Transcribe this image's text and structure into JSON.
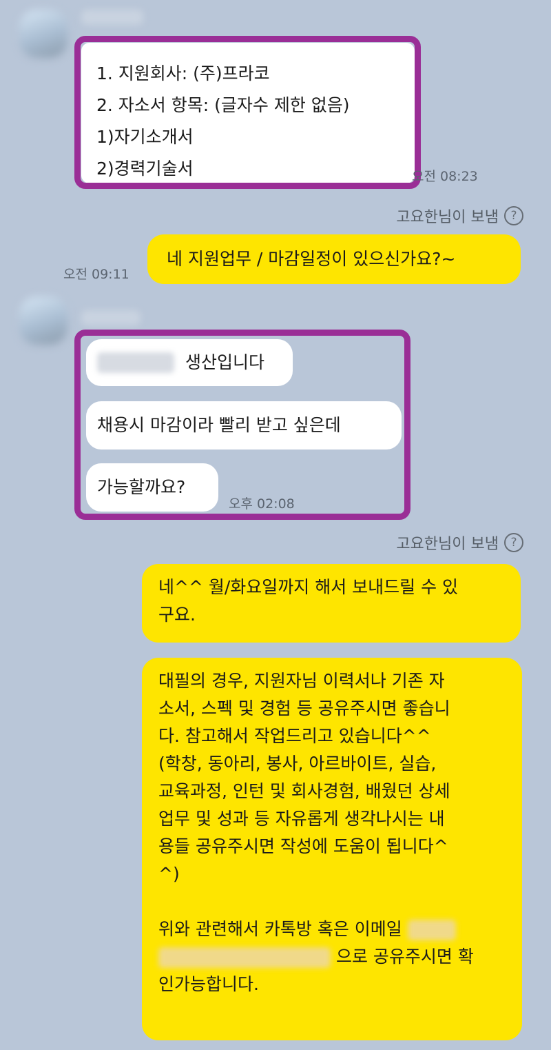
{
  "messages": {
    "first_received": {
      "lines": [
        "1. 지원회사: (주)프라코",
        "2. 자소서 항목: (글자수 제한 없음)",
        "1)자기소개서",
        "2)경력기술서"
      ],
      "time": "오전 08:23"
    },
    "sent_notice_1": "고요한님이 보냄",
    "question": {
      "text": "네 지원업무 / 마감일정이 있으신가요?~",
      "time": "오전 09:11"
    },
    "second_received": {
      "bubble1": "생산입니다",
      "bubble2": "채용시 마감이라 빨리 받고 싶은데",
      "bubble3": "가능할까요?",
      "time": "오후 02:08"
    },
    "sent_notice_2": "고요한님이 보냄",
    "reply1": {
      "lines": [
        "네^^ 월/화요일까지 해서 보내드릴 수 있",
        "구요."
      ]
    },
    "reply2": {
      "lines": [
        "대필의 경우, 지원자님 이력서나 기존 자",
        "소서, 스펙 및 경험 등 공유주시면 좋습니",
        "다. 참고해서 작업드리고 있습니다^^",
        "(학창, 동아리, 봉사, 아르바이트, 실습,",
        "교육과정, 인턴 및 회사경험, 배웠던 상세",
        "업무 및 성과 등 자유롭게 생각나시는 내",
        "용들 공유주시면 작성에 도움이 됩니다^",
        "^)"
      ],
      "email_prefix": "위와 관련해서 카톡방 혹은 이메일",
      "email_suffix": "으로 공유주시면 확",
      "last_line": "인가능합니다."
    }
  },
  "icons": {
    "info": "question-circle-icon"
  },
  "colors": {
    "background": "#b9c6d8",
    "received_bubble": "#ffffff",
    "sent_bubble": "#fee500",
    "highlight_border": "#9a2e96"
  }
}
